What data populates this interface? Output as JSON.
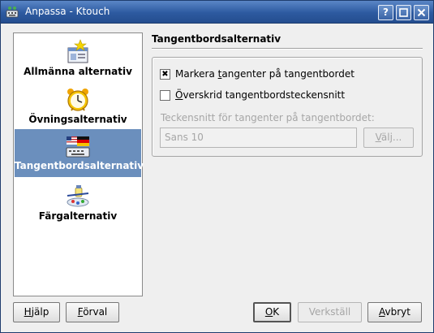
{
  "window": {
    "title": "Anpassa - Ktouch",
    "app_icon": "ktouch-keyboard-icon"
  },
  "titlebar_buttons": [
    {
      "name": "help",
      "label": "?"
    },
    {
      "name": "maximize",
      "label": "□"
    },
    {
      "name": "close",
      "label": "✕"
    }
  ],
  "sidebar": {
    "items": [
      {
        "label": "Allmänna alternativ",
        "icon": "general-settings-icon",
        "selected": false
      },
      {
        "label": "Övningsalternativ",
        "icon": "alarm-clock-icon",
        "selected": false
      },
      {
        "label": "Tangentbordsalternativ",
        "icon": "keyboard-flags-icon",
        "selected": true
      },
      {
        "label": "Färgalternativ",
        "icon": "color-palette-icon",
        "selected": false
      }
    ]
  },
  "main": {
    "title": "Tangentbordsalternativ",
    "checkbox1": {
      "pre": "Markera ",
      "mnemonic": "t",
      "post": "angenter på tangentbordet",
      "checked": true
    },
    "checkbox2": {
      "pre": "",
      "mnemonic": "Ö",
      "post": "verskrid tangentbordsteckensnitt",
      "checked": false
    },
    "font_label": "Teckensnitt för tangenter på tangentbordet:",
    "font_value": "Sans 10",
    "choose_button": {
      "pre": "",
      "mnemonic": "V",
      "post": "älj..."
    }
  },
  "buttons": {
    "help": {
      "pre": "",
      "mnemonic": "H",
      "post": "jälp"
    },
    "defaults": {
      "pre": "",
      "mnemonic": "F",
      "post": "örval"
    },
    "ok": {
      "pre": "",
      "mnemonic": "O",
      "post": "K"
    },
    "apply": {
      "pre": "Verkställ",
      "mnemonic": "",
      "post": ""
    },
    "cancel": {
      "pre": "",
      "mnemonic": "A",
      "post": "vbryt"
    }
  },
  "colors": {
    "titlebar": "#2d5aa0",
    "selection": "#6b8fbd",
    "dialog_bg": "#efefef"
  }
}
